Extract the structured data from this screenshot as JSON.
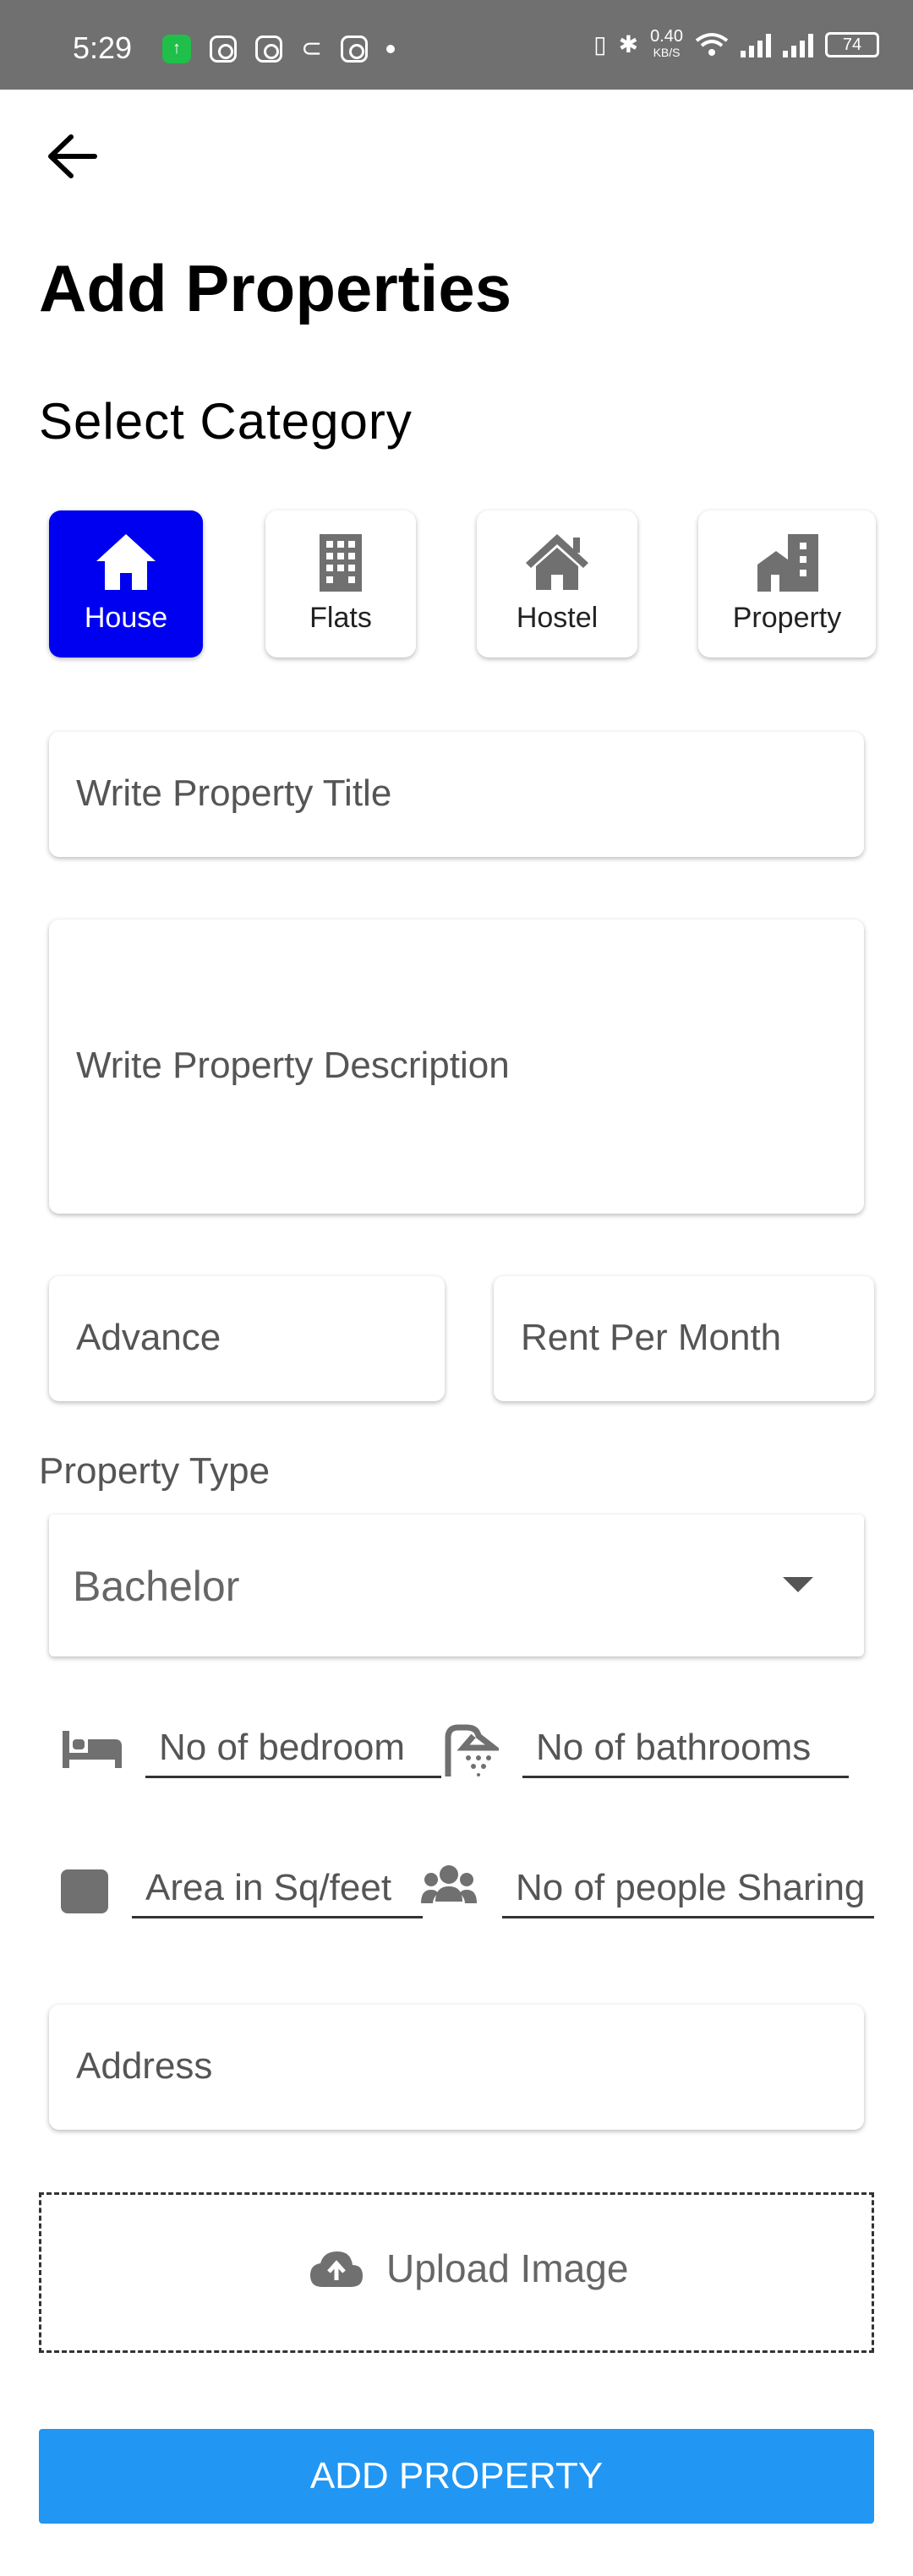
{
  "status_bar": {
    "time": "5:29",
    "speed_value": "0.40",
    "speed_unit": "KB/S",
    "battery": "74"
  },
  "header": {
    "title": "Add Properties",
    "subtitle": "Select Category"
  },
  "categories": [
    {
      "label": "House",
      "icon": "house-icon",
      "selected": true
    },
    {
      "label": "Flats",
      "icon": "building-icon",
      "selected": false
    },
    {
      "label": "Hostel",
      "icon": "hostel-icon",
      "selected": false
    },
    {
      "label": "Property",
      "icon": "city-icon",
      "selected": false
    }
  ],
  "form": {
    "title_placeholder": "Write Property Title",
    "description_placeholder": "Write Property Description",
    "advance_placeholder": "Advance",
    "rent_placeholder": "Rent Per Month",
    "property_type_label": "Property Type",
    "property_type_value": "Bachelor",
    "bedroom_placeholder": "No of bedroom",
    "bathroom_placeholder": "No of bathrooms",
    "area_placeholder": "Area in Sq/feet",
    "people_placeholder": "No of people Sharing",
    "address_placeholder": "Address",
    "upload_label": "Upload Image",
    "submit_label": "ADD PROPERTY"
  },
  "colors": {
    "selected_category": "#0000f0",
    "submit_button": "#2196f3",
    "status_bar": "#707070"
  }
}
